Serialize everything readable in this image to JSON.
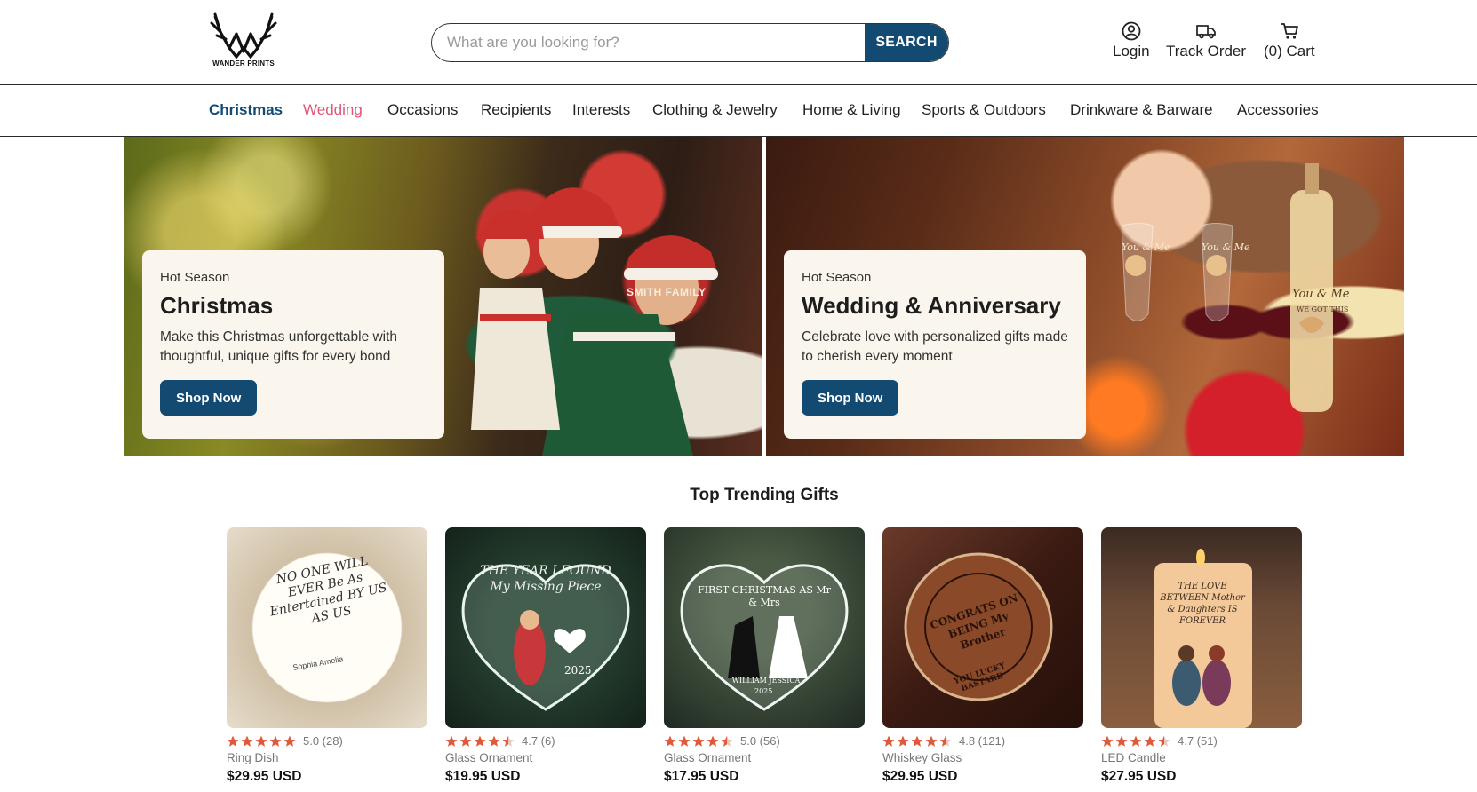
{
  "header": {
    "logo_text": "WANDER PRINTS",
    "search_placeholder": "What are you looking for?",
    "search_button": "SEARCH",
    "login": "Login",
    "track_order": "Track Order",
    "cart": "(0) Cart"
  },
  "nav": {
    "items": [
      "Christmas",
      "Wedding",
      "Occasions",
      "Recipients",
      "Interests",
      "Clothing & Jewelry",
      "Home & Living",
      "Sports & Outdoors",
      "Drinkware & Barware",
      "Accessories"
    ]
  },
  "hero": {
    "left": {
      "kicker": "Hot Season",
      "title": "Christmas",
      "desc": "Make this Christmas unforgettable with thoughtful, unique gifts for every bond",
      "button": "Shop Now",
      "sweater_text": "SMITH FAMILY"
    },
    "right": {
      "kicker": "Hot Season",
      "title": "Wedding & Anniversary",
      "desc": "Celebrate love with personalized gifts made to cherish every moment",
      "button": "Shop Now",
      "glass_text": "You & Me",
      "bottle_sub": "WE GOT THIS"
    }
  },
  "trending": {
    "title": "Top Trending Gifts",
    "products": [
      {
        "rating": "5.0 (28)",
        "stars": 5.0,
        "category": "Ring Dish",
        "price": "$29.95 USD",
        "art_text": "NO ONE WILL EVER Be As Entertained BY US AS US",
        "art_names": "Sophia  Amelia"
      },
      {
        "rating": "4.7 (6)",
        "stars": 4.5,
        "category": "Glass Ornament",
        "price": "$19.95 USD",
        "art_text": "THE YEAR I FOUND My Missing Piece",
        "art_year": "2025"
      },
      {
        "rating": "5.0 (56)",
        "stars": 4.5,
        "category": "Glass Ornament",
        "price": "$17.95 USD",
        "art_text": "FIRST CHRISTMAS AS Mr & Mrs",
        "art_names": "WILLIAM  JESSICA",
        "art_year": "2025"
      },
      {
        "rating": "4.8 (121)",
        "stars": 4.5,
        "category": "Whiskey Glass",
        "price": "$29.95 USD",
        "art_text": "CONGRATS ON BEING My Brother",
        "art_sub": "YOU LUCKY BASTARD"
      },
      {
        "rating": "4.7 (51)",
        "stars": 4.5,
        "category": "LED Candle",
        "price": "$27.95 USD",
        "art_text": "THE LOVE BETWEEN Mother & Daughters IS FOREVER"
      }
    ]
  },
  "colors": {
    "brand": "#134a72",
    "wedding": "#e0577a",
    "star": "#e05a3a"
  }
}
